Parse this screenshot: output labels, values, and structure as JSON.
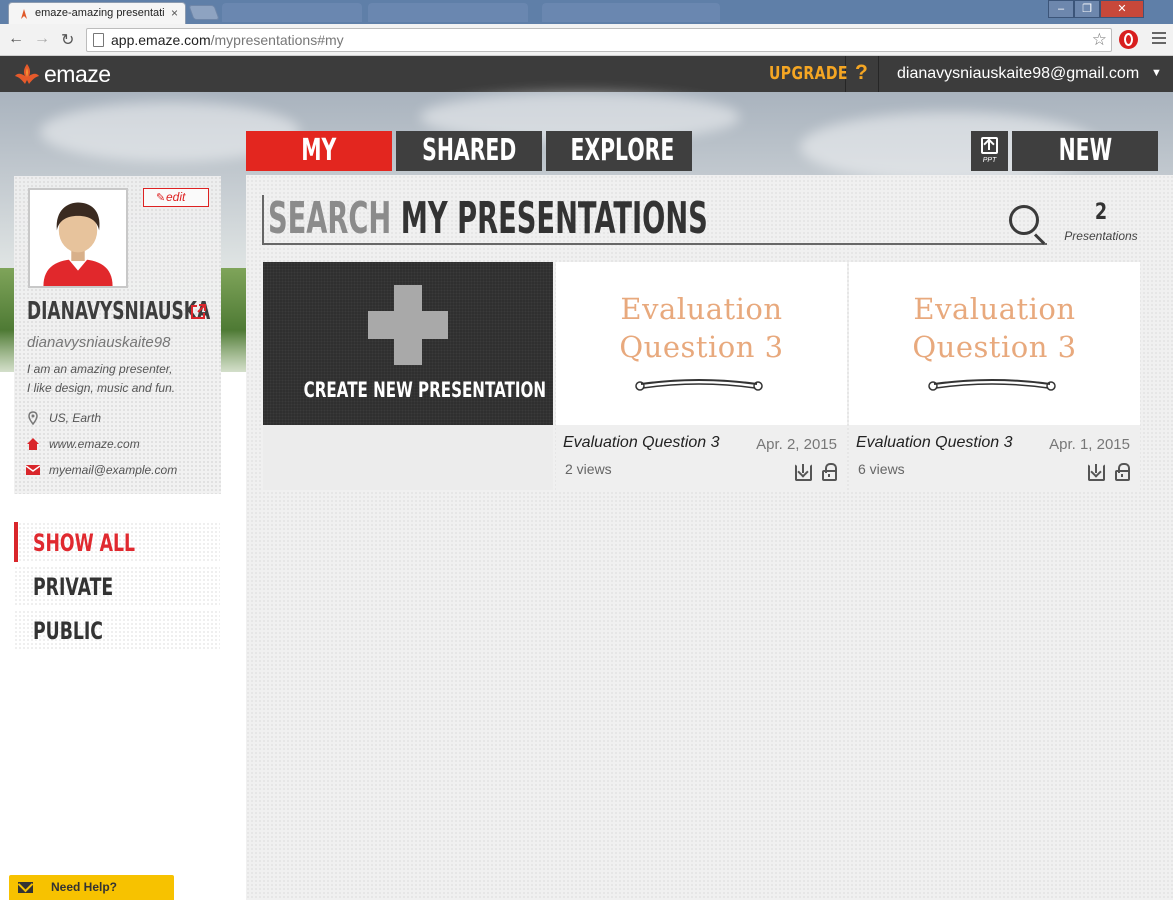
{
  "browser": {
    "active_tab_title": "emaze-amazing presentati",
    "tab_close": "×",
    "url_host": "app.emaze.com",
    "url_path": "/mypresentations#my"
  },
  "header": {
    "logo_text": "emaze",
    "upgrade_label": "UPGRADE",
    "help_label": "?",
    "user_email": "dianavysniauskaite98@gmail.com",
    "caret": "▼"
  },
  "tabs": [
    {
      "label": "MY"
    },
    {
      "label": "SHARED"
    },
    {
      "label": "EXPLORE"
    }
  ],
  "toolbar": {
    "ppt_label": "PPT",
    "new_label": "NEW"
  },
  "profile": {
    "edit_label": "edit",
    "name": "DIANAVYSNIAUSKA",
    "username": "dianavysniauskaite98",
    "bio_line1": "I am an amazing presenter,",
    "bio_line2": "I like design, music and fun.",
    "location": "US, Earth",
    "website": "www.emaze.com",
    "email": "myemail@example.com"
  },
  "filters": [
    {
      "label": "SHOW ALL"
    },
    {
      "label": "PRIVATE"
    },
    {
      "label": "PUBLIC"
    }
  ],
  "search": {
    "muted_text": "SEARCH",
    "dark_text": " MY PRESENTATIONS"
  },
  "summary": {
    "count": "2",
    "label": "Presentations"
  },
  "create_card": {
    "label": "CREATE NEW PRESENTATION"
  },
  "presentations": [
    {
      "thumb_line1": "Evaluation",
      "thumb_line2": "Question 3",
      "title": "Evaluation Question 3",
      "date": "Apr. 2, 2015",
      "views": "2 views"
    },
    {
      "thumb_line1": "Evaluation",
      "thumb_line2": "Question 3",
      "title": "Evaluation Question 3",
      "date": "Apr. 1, 2015",
      "views": "6 views"
    }
  ],
  "help_widget": {
    "label": "Need Help?"
  },
  "colors": {
    "accent_red": "#e3261f",
    "upgrade_orange": "#f5a623",
    "header_dark": "#3c3c3c",
    "thumb_text": "#e8a97d",
    "help_yellow": "#f7c200"
  }
}
